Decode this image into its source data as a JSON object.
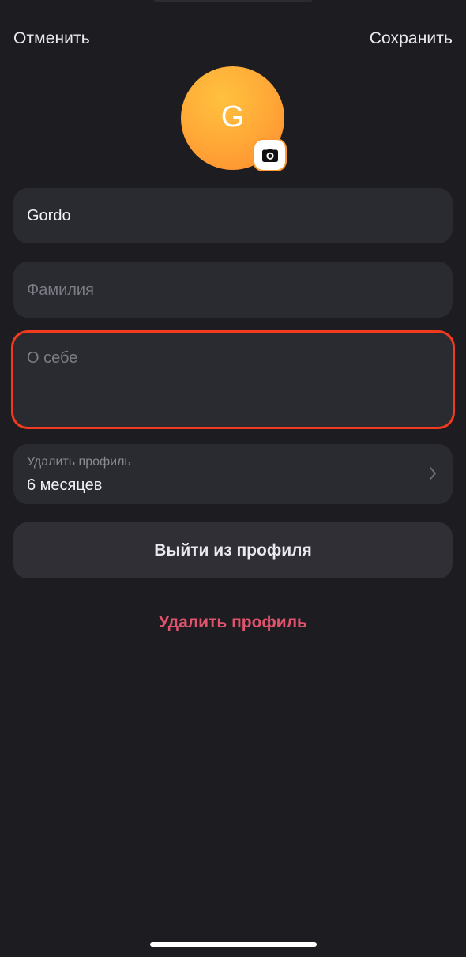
{
  "header": {
    "cancel_label": "Отменить",
    "save_label": "Сохранить"
  },
  "avatar": {
    "initial": "G",
    "badge_icon": "camera-icon",
    "gradient_colors": [
      "#ffc13e",
      "#ff8a2e"
    ]
  },
  "form": {
    "first_name_value": "Gordo",
    "last_name_placeholder": "Фамилия",
    "about_placeholder": "О себе",
    "delete_period": {
      "label": "Удалить профиль",
      "value": "6 месяцев",
      "icon": "chevron-right-icon"
    }
  },
  "actions": {
    "logout_label": "Выйти из профиля",
    "delete_label": "Удалить профиль"
  },
  "colors": {
    "background": "#1c1c21",
    "field_background": "#2a2a31",
    "highlight_border": "#f23a1f",
    "danger_text": "#e0536d"
  }
}
